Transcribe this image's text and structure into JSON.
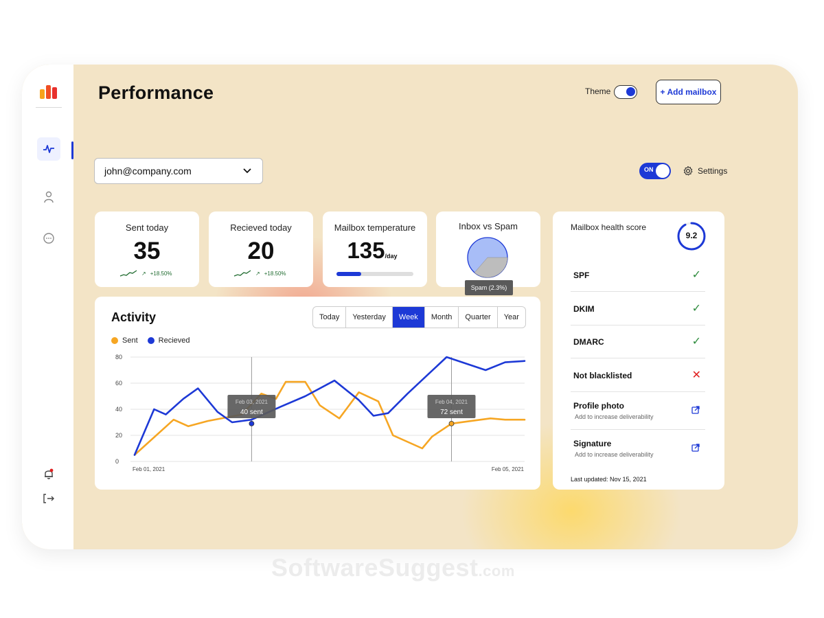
{
  "header": {
    "title": "Performance",
    "theme_label": "Theme",
    "add_mailbox": "+ Add mailbox"
  },
  "mailbox_select": {
    "value": "john@company.com"
  },
  "auto_toggle": {
    "label": "ON",
    "state": "on"
  },
  "settings_label": "Settings",
  "sidebar": {
    "icons": [
      "activity-icon",
      "user-icon",
      "chat-icon",
      "bell-icon",
      "logout-icon"
    ],
    "active": "activity-icon"
  },
  "stats": {
    "sent": {
      "label": "Sent today",
      "value": "35",
      "change": "+18.50%"
    },
    "received": {
      "label": "Recieved today",
      "value": "20",
      "change": "+18.50%"
    },
    "temperature": {
      "label": "Mailbox temperature",
      "value": "135",
      "unit": "/day",
      "progress": 0.32
    },
    "inbox_spam": {
      "label": "Inbox vs Spam",
      "tooltip": "Spam (2.3%)"
    }
  },
  "activity": {
    "title": "Activity",
    "ranges": [
      "Today",
      "Yesterday",
      "Week",
      "Month",
      "Quarter",
      "Year"
    ],
    "active_range": "Week",
    "tooltips": [
      {
        "date": "Feb 03, 2021",
        "text": "40 sent"
      },
      {
        "date": "Feb 04, 2021",
        "text": "72 sent"
      }
    ]
  },
  "chart_data": {
    "type": "line",
    "x_start_label": "Feb 01, 2021",
    "x_end_label": "Feb 05, 2021",
    "ylim": [
      0,
      80
    ],
    "yticks": [
      0,
      20,
      40,
      60,
      80
    ],
    "grid": true,
    "legend_position": "top-left",
    "series": [
      {
        "name": "Sent",
        "color": "#f6a623",
        "x": [
          0,
          0.4,
          0.55,
          0.75,
          1.1,
          1.3,
          1.45,
          1.55,
          1.75,
          1.9,
          2.1,
          2.3,
          2.5,
          2.65,
          2.95,
          3.05,
          3.25,
          3.45,
          3.65,
          3.8,
          4.0
        ],
        "y": [
          5,
          32,
          27,
          31,
          36,
          52,
          48,
          61,
          61,
          43,
          33,
          53,
          46,
          20,
          10,
          19,
          29,
          31,
          33,
          32,
          32
        ]
      },
      {
        "name": "Recieved",
        "color": "#1d39d6",
        "x": [
          0,
          0.2,
          0.32,
          0.5,
          0.65,
          0.85,
          1.0,
          1.2,
          1.5,
          1.75,
          2.05,
          2.3,
          2.45,
          2.6,
          2.8,
          3.0,
          3.2,
          3.4,
          3.6,
          3.8,
          4.0
        ],
        "y": [
          5,
          40,
          36,
          48,
          56,
          38,
          30,
          32,
          42,
          50,
          62,
          47,
          35,
          37,
          52,
          66,
          80,
          75,
          70,
          76,
          77
        ]
      }
    ],
    "points": [
      {
        "series": "Recieved",
        "x": 1.2,
        "y": 29
      },
      {
        "series": "Sent",
        "x": 3.25,
        "y": 29
      }
    ],
    "crosshairs_x": [
      1.2,
      3.25
    ]
  },
  "health": {
    "title": "Mailbox health score",
    "score": "9.2",
    "score_fraction": 0.92,
    "items": [
      {
        "label": "SPF",
        "status": "ok",
        "icon": "check-icon"
      },
      {
        "label": "DKIM",
        "status": "ok",
        "icon": "check-icon"
      },
      {
        "label": "DMARC",
        "status": "ok",
        "icon": "check-icon"
      },
      {
        "label": "Not blacklisted",
        "status": "fail",
        "icon": "cross-icon"
      },
      {
        "label": "Profile photo",
        "sub": "Add to increase deliverability",
        "icon": "external-link-icon"
      },
      {
        "label": "Signature",
        "sub": "Add to increase deliverability",
        "icon": "external-link-icon"
      }
    ],
    "last_updated": "Last updated: Nov 15, 2021"
  },
  "watermark": {
    "main": "SoftwareSuggest",
    "suffix": ".com"
  },
  "colors": {
    "accent": "#1d39d6",
    "sent": "#f6a623",
    "background": "#f3e4c6"
  }
}
